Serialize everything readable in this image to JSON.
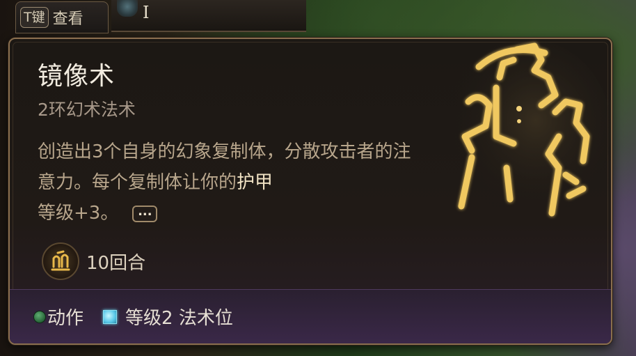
{
  "hotbar": {
    "glyph": "I"
  },
  "key_hint": {
    "key": "T键",
    "label": "查看"
  },
  "spell": {
    "name": "镜像术",
    "subtitle": "2环幻术法术",
    "description_prefix": "创造出3个自身的幻象复制体，分散攻击者的注意力。每个复制体让你的",
    "description_highlight": "护甲",
    "description_suffix": "等级+3。",
    "more_label": "...",
    "duration": "10回合",
    "icon": "mirror-image-icon"
  },
  "costs": [
    {
      "label": "动作",
      "icon": "action-dot-icon",
      "color": "#3f8a52"
    },
    {
      "label": "等级2 法术位",
      "icon": "spell-slot-icon",
      "color": "#59c8e8"
    }
  ],
  "colors": {
    "panel_border": "#8a6e4e",
    "title": "#f2ece0",
    "description": "#b8a68c",
    "highlight": "#f0e2c4",
    "rune_gold": "#e8b84a"
  }
}
